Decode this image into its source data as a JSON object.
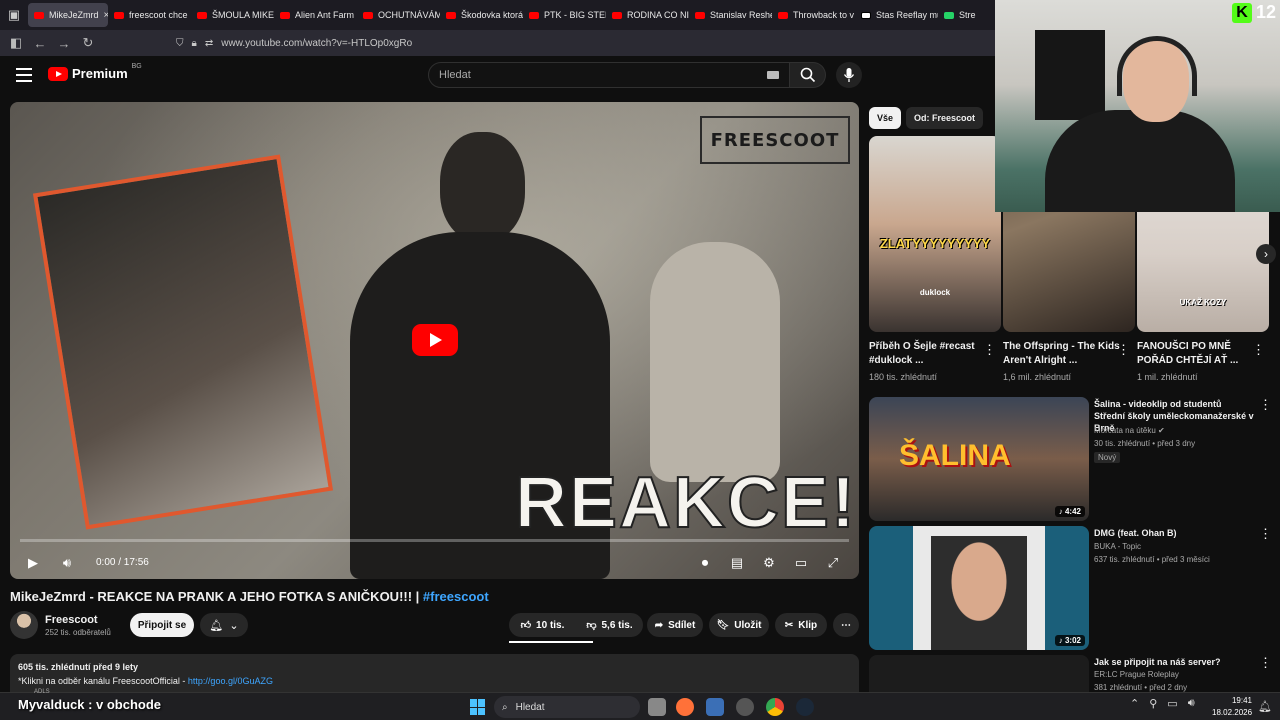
{
  "browser": {
    "tabs": [
      {
        "label": "MikeJeZmrd",
        "active": true,
        "icon": "youtube-icon"
      },
      {
        "label": "freescoot chce",
        "icon": "youtube-icon"
      },
      {
        "label": "ŠMOULA MIKE",
        "icon": "youtube-icon"
      },
      {
        "label": "Alien Ant Farm",
        "icon": "youtube-icon"
      },
      {
        "label": "OCHUTNÁVÁM",
        "icon": "youtube-icon"
      },
      {
        "label": "Škodovka ktorá",
        "icon": "youtube-icon"
      },
      {
        "label": "PTK - BIG STEP",
        "icon": "youtube-icon"
      },
      {
        "label": "RODINA CO NI",
        "icon": "youtube-icon"
      },
      {
        "label": "Stanislav Reshe",
        "icon": "youtube-icon"
      },
      {
        "label": "Throwback to v",
        "icon": "tou-icon"
      },
      {
        "label": "Stas Reeflay mu",
        "icon": "bookmark-icon"
      },
      {
        "label": "Stre",
        "icon": "kick-icon"
      }
    ],
    "tab_close": "×",
    "url": "www.youtube.com/watch?v=-HTLOp0xgRo"
  },
  "youtube": {
    "logo_text": "Premium",
    "logo_country": "BG",
    "search_placeholder": "Hledat"
  },
  "player": {
    "watermark": "FREESCOOT",
    "overlay_text": "REAKCE!",
    "time": "0:00 / 17:56",
    "progress_fraction": 0.0
  },
  "video": {
    "title": "MikeJeZmrd - REAKCE NA PRANK A JEHO FOTKA S ANIČKOU!!! | ",
    "title_tag": "#freescoot",
    "channel": "Freescoot",
    "subscribers": "252 tis. odběratelů",
    "subscribe_label": "Připojit se",
    "likes": "10 tis.",
    "dislikes": "5,6 tis.",
    "share": "Sdílet",
    "save": "Uložit",
    "clip": "Klip",
    "more": "⋯",
    "desc_meta": "605 tis. zhlédnutí  před 9 lety",
    "desc_line": "*Klikni na odběr kanálu FreescootOfficial - ",
    "desc_link": "http://goo.gl/0GuAZG"
  },
  "sidebar": {
    "chips": [
      "Vše",
      "Od: Freescoot"
    ],
    "shorts": [
      {
        "title": "Příběh O Šejle #recast #duklock ...",
        "views": "180 tis. zhlédnutí",
        "overlay": "ZLATYYYYYYYYY",
        "overlay2": "duklock"
      },
      {
        "title": "The Offspring - The Kids Aren't Alright ...",
        "views": "1,6 mil. zhlédnutí"
      },
      {
        "title": "FANOUŠCI PO MNĚ POŘÁD CHTĚJÍ AŤ ...",
        "views": "1 mil. zhlédnutí",
        "overlay": "UKAŽ KOZY"
      }
    ],
    "videos": [
      {
        "title": "Šalina - videoklip od studentů Střední školy uměleckomanažerské v Brně",
        "channel": "Morčata na útěku",
        "meta": "30 tis. zhlédnutí • před 3 dny",
        "badge": "Nový",
        "duration": "4:42",
        "thumb_text": "ŠALINA"
      },
      {
        "title": "DMG (feat. Ohan B)",
        "channel": "BUKA - Topic",
        "meta": "637 tis. zhlédnutí • před 3 měsíci",
        "duration": "3:02"
      },
      {
        "title": "Jak se připojit na náš server?",
        "channel": "ER:LC Prague Roleplay",
        "meta": "381 zhlédnutí • před 2 dny"
      }
    ]
  },
  "webcam": {
    "badge_count": "12",
    "badge_letter": "K"
  },
  "taskbar": {
    "streamer_text": "Myvalduck : v obchode",
    "small_label": "ADLS",
    "search_label": "Hledat",
    "time": "19:41",
    "date": "18.02.2026"
  }
}
